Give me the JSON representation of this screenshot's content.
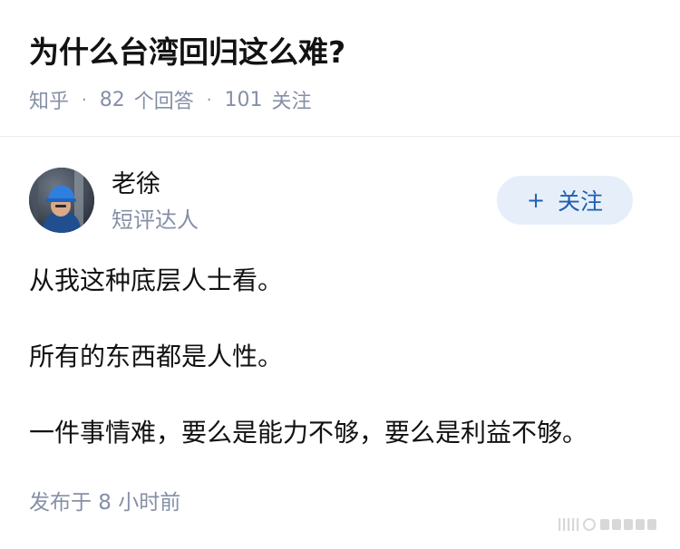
{
  "question": {
    "title": "为什么台湾回归这么难?",
    "source": "知乎",
    "answer_count": "82",
    "answer_label": "个回答",
    "follower_count": "101",
    "follower_label": "关注"
  },
  "author": {
    "name": "老徐",
    "badge": "短评达人",
    "follow_button_label": "关注",
    "follow_icon": "plus-icon"
  },
  "answer": {
    "paragraphs": [
      "从我这种底层人士看。",
      "所有的东西都是人性。",
      "一件事情难，要么是能力不够，要么是利益不够。"
    ],
    "published": "发布于  8 小时前"
  },
  "colors": {
    "title": "#121212",
    "meta_gray": "#8590a6",
    "follow_button_bg": "#e6eff9",
    "follow_button_text": "#1f5fb0",
    "divider": "#ebebeb"
  }
}
